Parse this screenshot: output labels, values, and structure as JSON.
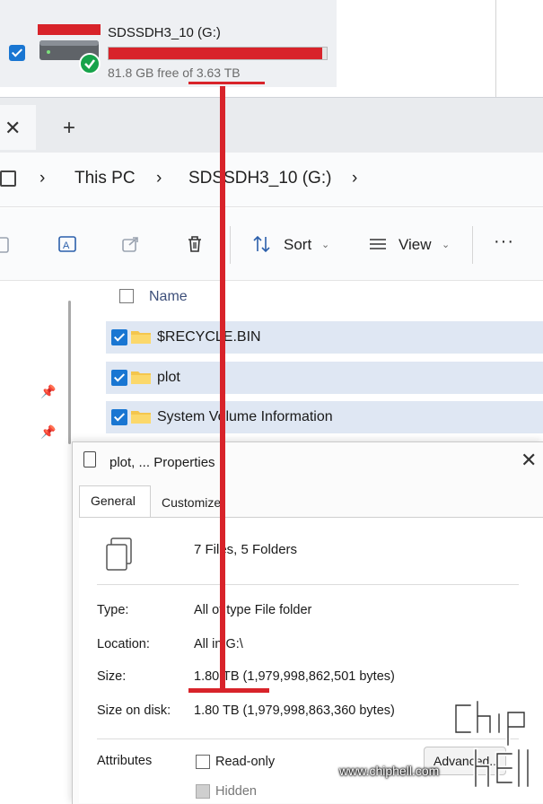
{
  "drive": {
    "name": "SDSSDH3_10 (G:)",
    "free_text": "81.8 GB free of 3.63 TB",
    "used_fraction": 0.978,
    "bar_color": "#d8232a"
  },
  "tabs": {
    "close_glyph": "✕",
    "new_tab_glyph": "+"
  },
  "breadcrumb": {
    "sep": "›",
    "this_pc": "This PC",
    "drive": "SDSSDH3_10 (G:)"
  },
  "toolbar": {
    "sort_label": "Sort",
    "view_label": "View",
    "chevron": "⌄",
    "more": "···"
  },
  "file_list": {
    "header": "Name",
    "rows": [
      {
        "label": "$RECYCLE.BIN"
      },
      {
        "label": "plot"
      },
      {
        "label": "System Volume Information"
      }
    ]
  },
  "dialog": {
    "title": "plot, ... Properties",
    "close_glyph": "✕",
    "tab_general": "General",
    "tab_customize": "Customize",
    "summary": "7 Files, 5 Folders",
    "type_label": "Type:",
    "type_value": "All of type File folder",
    "location_label": "Location:",
    "location_value": "All in G:\\",
    "size_label": "Size:",
    "size_value": "1.80 TB (1,979,998,862,501 bytes)",
    "size_on_disk_label": "Size on disk:",
    "size_on_disk_value": "1.80 TB (1,979,998,863,360 bytes)",
    "attributes_label": "Attributes",
    "read_only_label": "Read-only",
    "hidden_label": "Hidden",
    "advanced_label": "Advanced..."
  },
  "watermark": {
    "text": "www.chiphell.com",
    "logo_text": "chip hell"
  },
  "colors": {
    "accent": "#1976d2",
    "annotation_red": "#d8232a"
  }
}
